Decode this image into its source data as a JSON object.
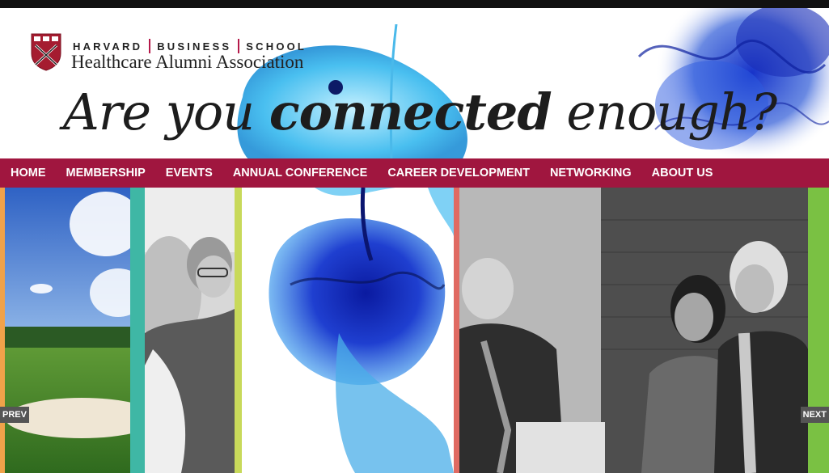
{
  "header": {
    "school_words": [
      "HARVARD",
      "BUSINESS",
      "SCHOOL"
    ],
    "association": "Healthcare Alumni Association",
    "tagline_start": "Are you ",
    "tagline_bold": "connected",
    "tagline_end": " enough?"
  },
  "nav": {
    "items": [
      "HOME",
      "MEMBERSHIP",
      "EVENTS",
      "ANNUAL CONFERENCE",
      "CAREER DEVELOPMENT",
      "NETWORKING",
      "ABOUT US"
    ]
  },
  "slideshow": {
    "prev_label": "PREV",
    "next_label": "NEXT"
  },
  "colors": {
    "nav_background": "#a0163f",
    "accent_orange": "#f0a24a",
    "accent_teal": "#3fb7a5",
    "accent_lime": "#c8d95a",
    "accent_coral": "#e06a62",
    "accent_green": "#7ac143",
    "ink_blue": "#1c3fbf"
  }
}
